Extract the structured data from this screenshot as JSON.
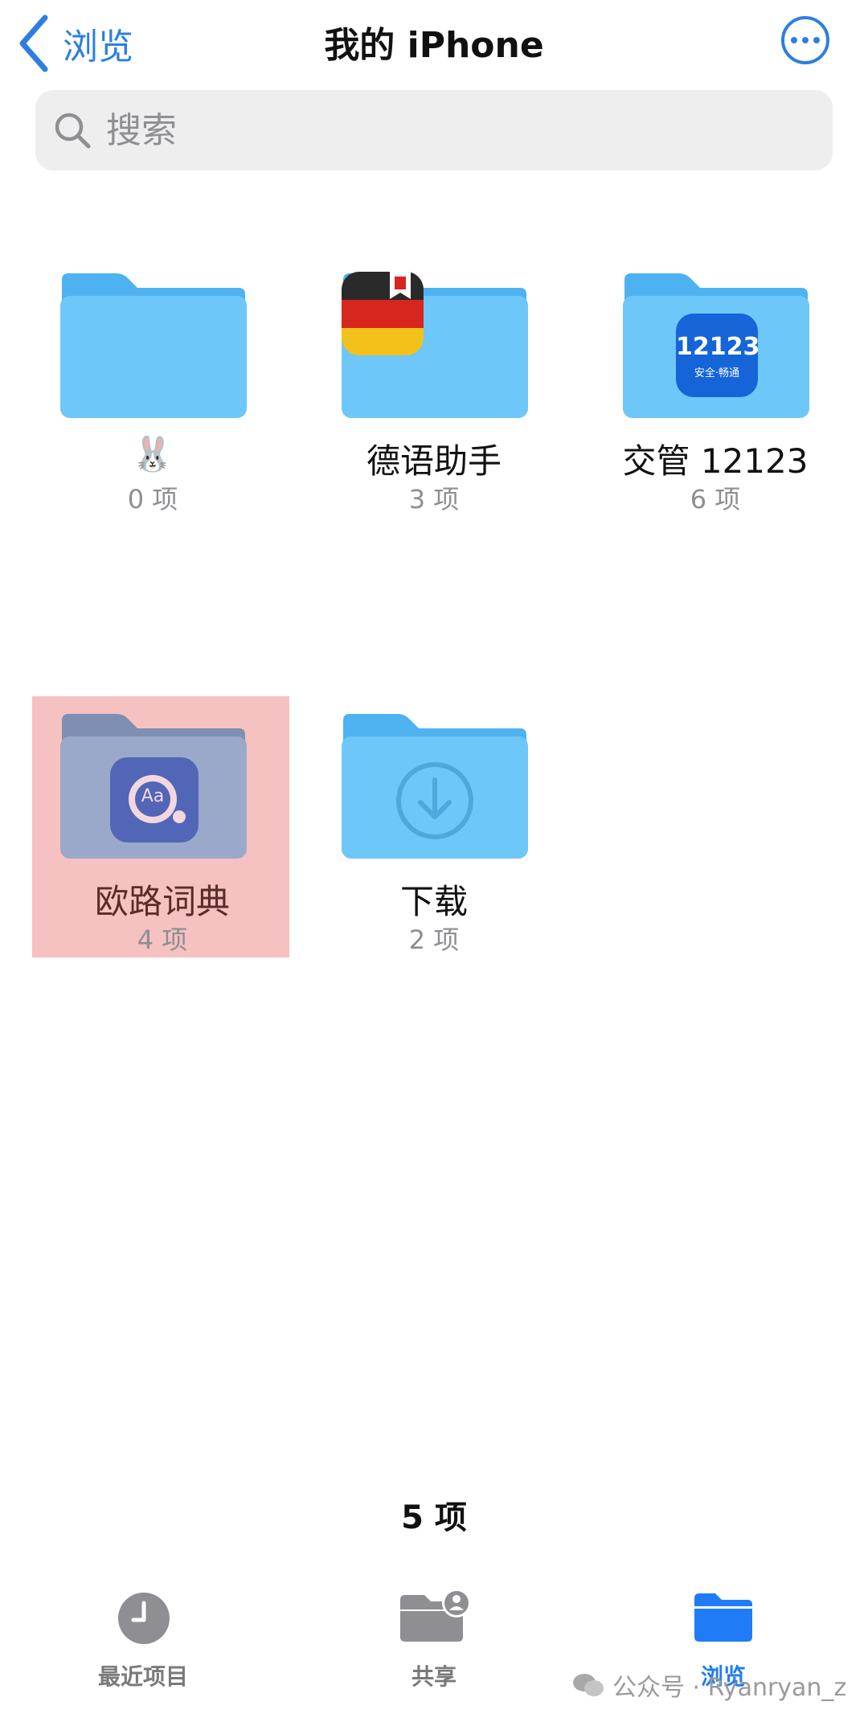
{
  "header": {
    "back_label": "浏览",
    "title": "我的 iPhone"
  },
  "search": {
    "placeholder": "搜索"
  },
  "folders": [
    {
      "name": "🐰",
      "count": "0 项",
      "icon": "plain-folder"
    },
    {
      "name": "德语助手",
      "count": "3 项",
      "icon": "german-flag-app"
    },
    {
      "name": "交管 12123",
      "count": "6 项",
      "icon": "traffic-12123-app",
      "app_text": "12123",
      "app_subtext": "安全·畅通"
    },
    {
      "name": "欧路词典",
      "count": "4 项",
      "icon": "dictionary-app",
      "app_text": "Aa",
      "selected": true
    },
    {
      "name": "下载",
      "count": "2 项",
      "icon": "download-folder"
    }
  ],
  "summary": {
    "item_count": "5 项"
  },
  "tabs": [
    {
      "label": "最近项目",
      "icon": "clock-icon"
    },
    {
      "label": "共享",
      "icon": "shared-folder-icon"
    },
    {
      "label": "浏览",
      "icon": "folder-icon",
      "active": true
    }
  ],
  "watermark": "公众号 · Ryanryan_z",
  "colors": {
    "accent": "#2d7ee0",
    "folder": "#6ec7f9",
    "folder_tab": "#4fb2f0",
    "selected_bg": "#f6c1c1",
    "tab_active": "#1f7cf6"
  }
}
